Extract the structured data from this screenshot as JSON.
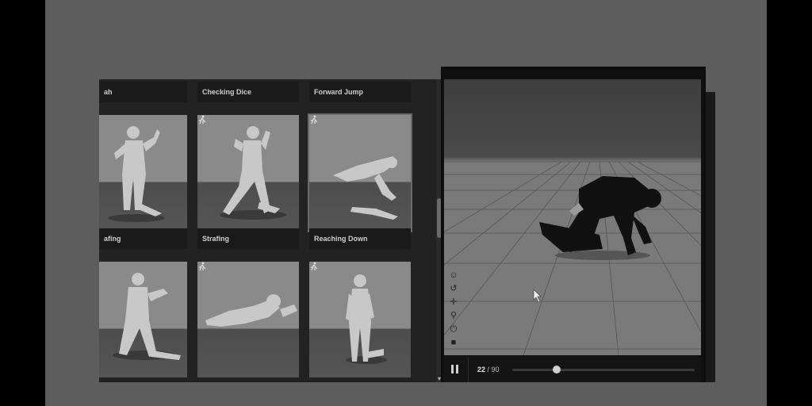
{
  "library": {
    "cards": [
      {
        "title": "ah",
        "pose": "punch"
      },
      {
        "title": "Checking Dice",
        "pose": "crouch"
      },
      {
        "title": "Forward Jump",
        "pose": "jump"
      },
      {
        "title": "afing",
        "pose": "strafe"
      },
      {
        "title": "Strafing",
        "pose": "crawl"
      },
      {
        "title": "Reaching Down",
        "pose": "stand"
      }
    ]
  },
  "player": {
    "current_frame": "22",
    "separator": " / ",
    "total_frames": "90",
    "progress": 0.244,
    "tools": [
      "smiley-icon",
      "undo-icon",
      "move-icon",
      "search-icon",
      "power-icon",
      "camera-icon"
    ]
  },
  "icons": {
    "run": "running-figure-icon",
    "pause": "pause-icon"
  },
  "colors": {
    "panel_bg": "#222222",
    "thumb_floor": "#4d4d4d",
    "thumb_sky": "#8a8a8a"
  }
}
